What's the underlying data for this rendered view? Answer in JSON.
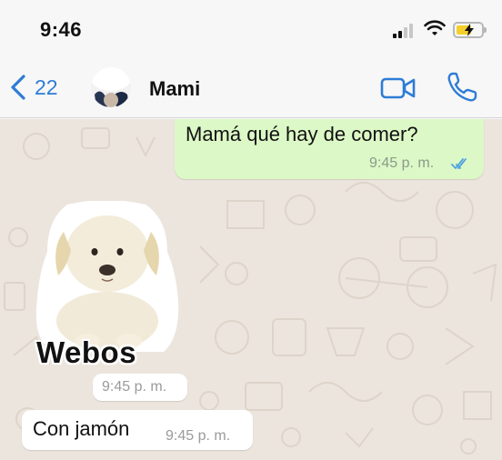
{
  "status_bar": {
    "time": "9:46",
    "battery_color": "#f5cf2c"
  },
  "header": {
    "back_count": "22",
    "contact_name": "Mami",
    "accent_color": "#2e7cd6",
    "icons": [
      "chevron-left-icon",
      "video-camera-icon",
      "phone-icon"
    ]
  },
  "messages": [
    {
      "direction": "outgoing",
      "type": "text",
      "text": "Mamá qué hay de comer?",
      "time": "9:45 p. m.",
      "status": "read"
    },
    {
      "direction": "incoming",
      "type": "sticker",
      "sticker_text": "Webos",
      "time": "9:45 p. m."
    },
    {
      "direction": "incoming",
      "type": "text",
      "text": "Con jamón",
      "time": "9:45 p. m."
    }
  ],
  "colors": {
    "outgoing_bubble": "#dcf8c6",
    "incoming_bubble": "#ffffff",
    "wallpaper": "#ece5dd",
    "read_ticks": "#4fa3e0"
  }
}
